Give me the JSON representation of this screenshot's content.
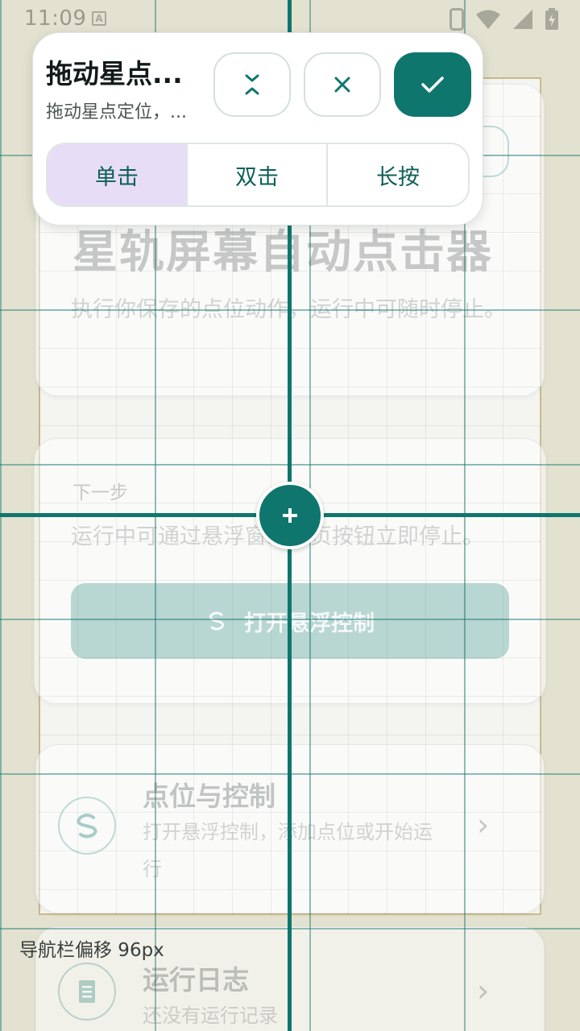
{
  "status_bar": {
    "time": "11:09",
    "a_icon_letter": "A",
    "icons": [
      "phone-icon",
      "wifi-icon",
      "signal-icon",
      "battery-charging-icon"
    ]
  },
  "panel": {
    "title": "拖动星点...",
    "subtitle": "拖动星点定位，...",
    "buttons": {
      "collapse_icon": "collapse-arrows-icon",
      "close_icon": "close-icon",
      "confirm_icon": "check-icon"
    },
    "click_modes": [
      {
        "label": "单击",
        "selected": true
      },
      {
        "label": "双击",
        "selected": false
      },
      {
        "label": "长按",
        "selected": false
      }
    ]
  },
  "background_app": {
    "title": "星轨屏幕自动点击器",
    "description": "执行你保存的点位动作，运行中可随时停止。",
    "next_step": {
      "label": "下一步",
      "description": "运行中可通过悬浮窗或首页按钮立即停止。",
      "button_label": "打开悬浮控制"
    },
    "list_items": [
      {
        "title": "点位与控制",
        "subtitle": "打开悬浮控制，添加点位或开始运行",
        "icon": "floating-control-icon"
      },
      {
        "title": "运行日志",
        "subtitle": "还没有运行记录",
        "icon": "log-icon"
      }
    ]
  },
  "overlay": {
    "nav_offset_label": "导航栏偏移 96px",
    "target_icon": "plus-icon"
  },
  "colors": {
    "accent": "#0f766e",
    "selected_segment": "#e7ddf6",
    "background": "#e3e1cf",
    "page_border": "#cdb98e"
  }
}
